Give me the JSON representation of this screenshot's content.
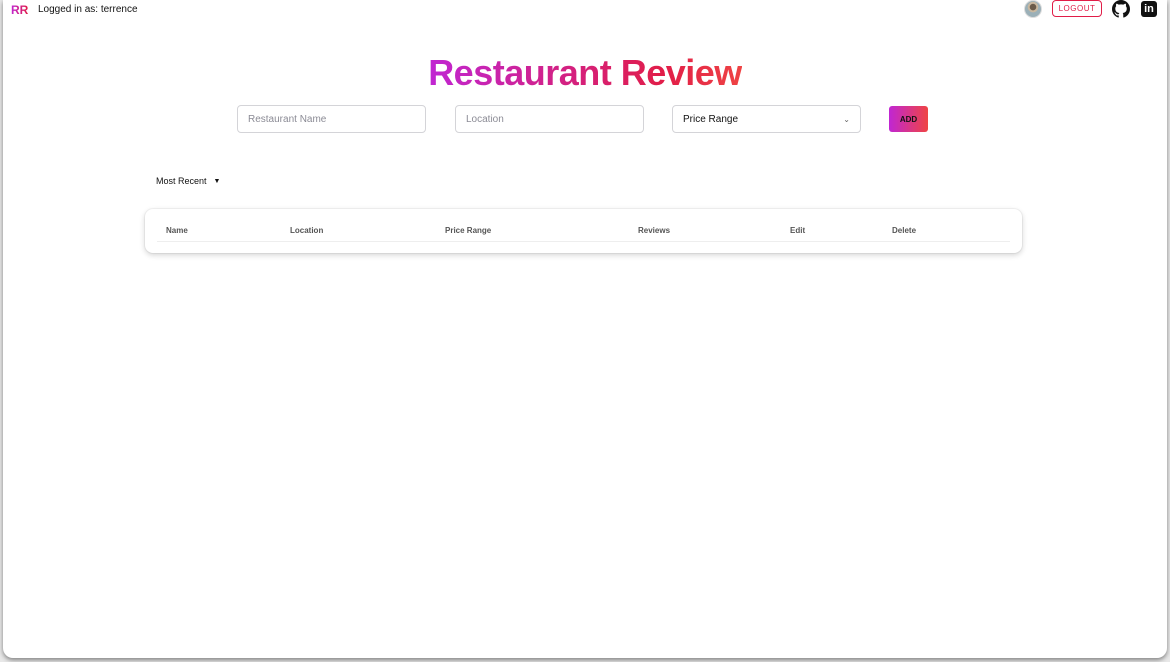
{
  "header": {
    "brand": "RR",
    "logged_in": "Logged in as: terrence",
    "logout_label": "LOGOUT",
    "linkedin_glyph": "in"
  },
  "page": {
    "title": "Restaurant Review"
  },
  "form": {
    "name_placeholder": "Restaurant Name",
    "location_placeholder": "Location",
    "price_selected": "Price Range",
    "add_label": "ADD"
  },
  "sort": {
    "selected": "Most Recent"
  },
  "table": {
    "columns": [
      "Name",
      "Location",
      "Price Range",
      "Reviews",
      "Edit",
      "Delete"
    ]
  },
  "colors": {
    "accent_start": "#c026d3",
    "accent_end": "#ef4444"
  },
  "icons": [
    "avatar",
    "github-icon",
    "linkedin-icon",
    "chevron-down-icon",
    "caret-down-icon"
  ]
}
